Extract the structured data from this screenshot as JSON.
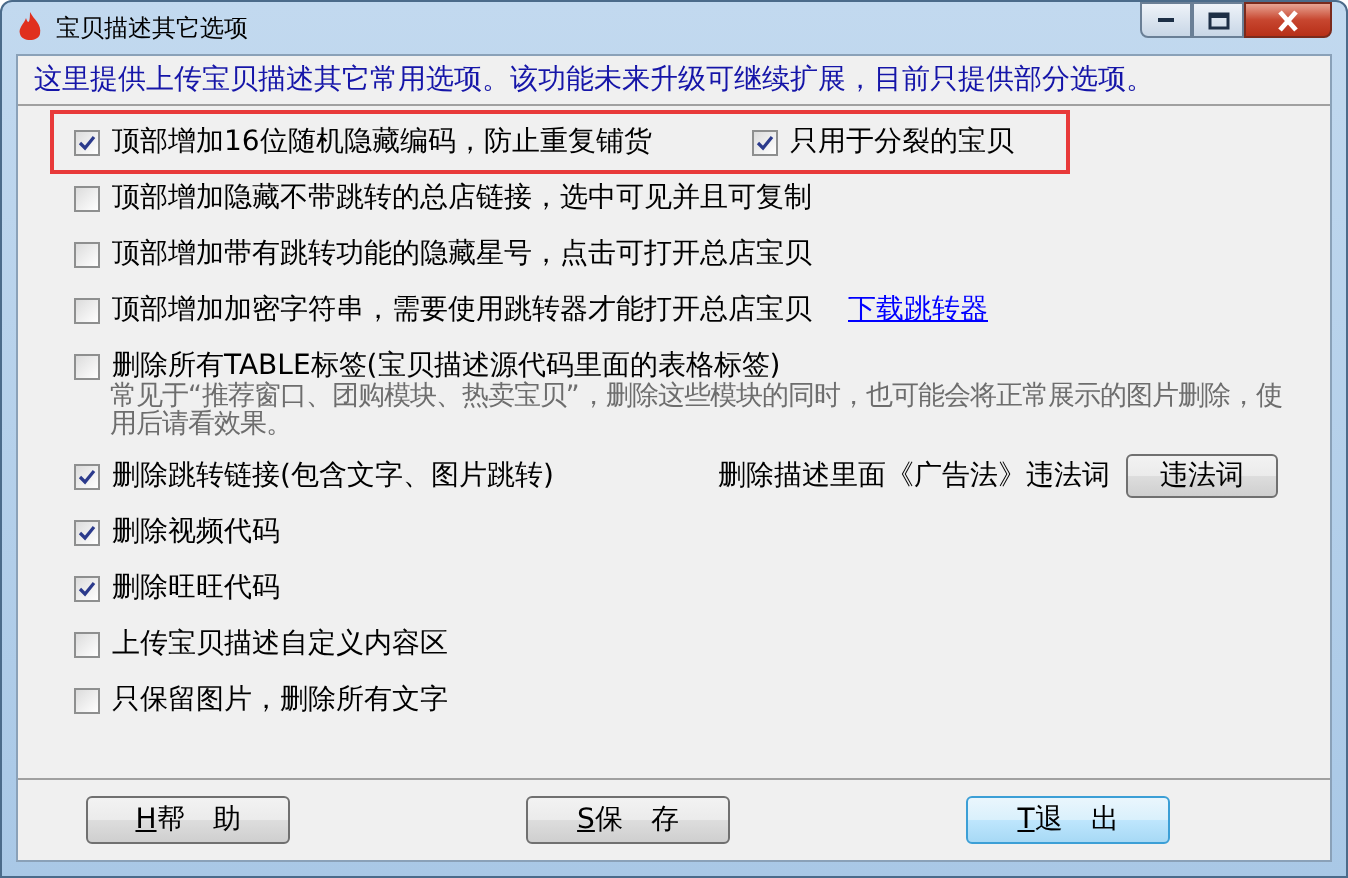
{
  "window": {
    "title": "宝贝描述其它选项"
  },
  "info": "这里提供上传宝贝描述其它常用选项。该功能未来升级可继续扩展，目前只提供部分选项。",
  "options": [
    {
      "kind": "checkbox",
      "label": "顶部增加16位随机隐藏编码，防止重复铺货",
      "checked": true,
      "highlighted": true,
      "sub_option": {
        "label": "只用于分裂的宝贝",
        "checked": true
      }
    },
    {
      "kind": "checkbox",
      "label": "顶部增加隐藏不带跳转的总店链接，选中可见并且可复制",
      "checked": false,
      "highlighted": false
    },
    {
      "kind": "checkbox",
      "label": "顶部增加带有跳转功能的隐藏星号，点击可打开总店宝贝",
      "checked": false,
      "highlighted": false
    },
    {
      "kind": "checkbox",
      "label": "顶部增加加密字符串，需要使用跳转器才能打开总店宝贝",
      "checked": false,
      "highlighted": false,
      "link": "下载跳转器"
    },
    {
      "kind": "checkbox",
      "label": "删除所有TABLE标签(宝贝描述源代码里面的表格标签)",
      "checked": false,
      "highlighted": false,
      "note": "常见于“推荐窗口、团购模块、热卖宝贝”，删除这些模块的同时，也可能会将正常展示的图片删除，使用后请看效果。"
    },
    {
      "kind": "checkbox",
      "label": "删除跳转链接(包含文字、图片跳转)",
      "checked": true,
      "highlighted": false,
      "side_label": "删除描述里面《广告法》违法词",
      "side_button": "违法词"
    },
    {
      "kind": "checkbox",
      "label": "删除视频代码",
      "checked": true,
      "highlighted": false
    },
    {
      "kind": "checkbox",
      "label": "删除旺旺代码",
      "checked": true,
      "highlighted": false
    },
    {
      "kind": "checkbox",
      "label": "上传宝贝描述自定义内容区",
      "checked": false,
      "highlighted": false
    },
    {
      "kind": "checkbox",
      "label": "只保留图片，删除所有文字",
      "checked": false,
      "highlighted": false
    }
  ],
  "buttons": [
    {
      "accelerator": "H",
      "label": "帮　助",
      "focused": false
    },
    {
      "accelerator": "S",
      "label": "保　存",
      "focused": false
    },
    {
      "accelerator": "T",
      "label": "退　出",
      "focused": true
    }
  ]
}
